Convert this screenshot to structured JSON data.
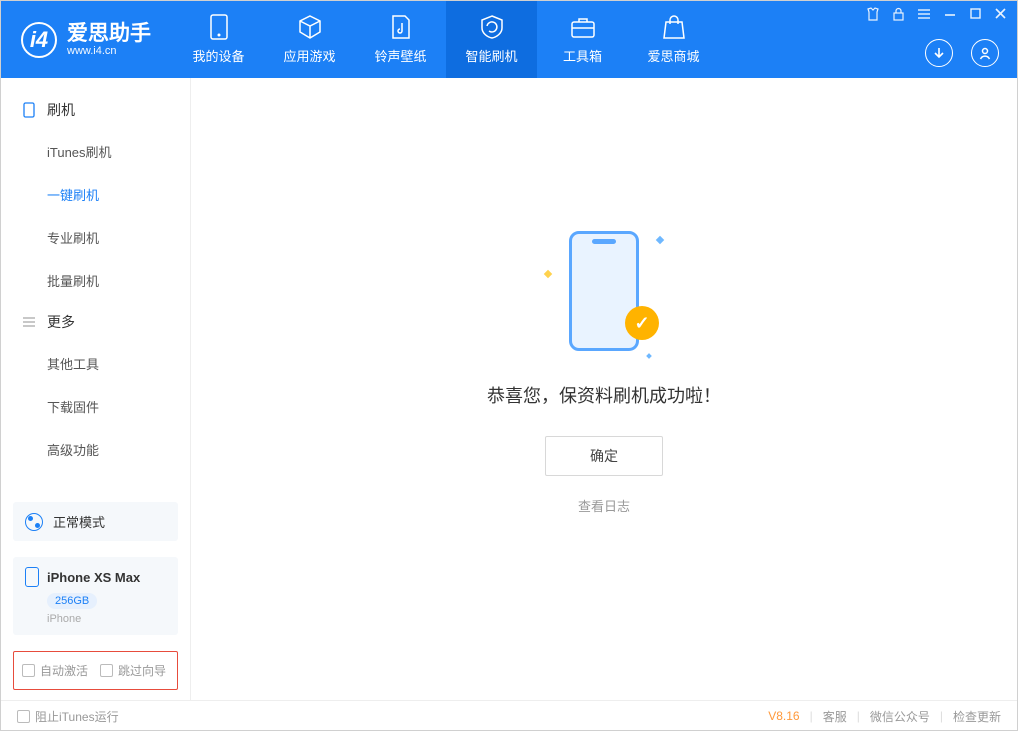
{
  "app": {
    "title": "爱思助手",
    "subtitle": "www.i4.cn"
  },
  "tabs": [
    {
      "label": "我的设备"
    },
    {
      "label": "应用游戏"
    },
    {
      "label": "铃声壁纸"
    },
    {
      "label": "智能刷机"
    },
    {
      "label": "工具箱"
    },
    {
      "label": "爱思商城"
    }
  ],
  "sidebar": {
    "group1": {
      "title": "刷机",
      "items": [
        "iTunes刷机",
        "一键刷机",
        "专业刷机",
        "批量刷机"
      ]
    },
    "group2": {
      "title": "更多",
      "items": [
        "其他工具",
        "下载固件",
        "高级功能"
      ]
    }
  },
  "mode": {
    "label": "正常模式"
  },
  "device": {
    "name": "iPhone XS Max",
    "storage": "256GB",
    "type": "iPhone"
  },
  "checks": {
    "auto_activate": "自动激活",
    "skip_guide": "跳过向导"
  },
  "main": {
    "message": "恭喜您，保资料刷机成功啦！",
    "ok": "确定",
    "log": "查看日志"
  },
  "footer": {
    "block_itunes": "阻止iTunes运行",
    "version": "V8.16",
    "service": "客服",
    "wechat": "微信公众号",
    "update": "检查更新"
  }
}
